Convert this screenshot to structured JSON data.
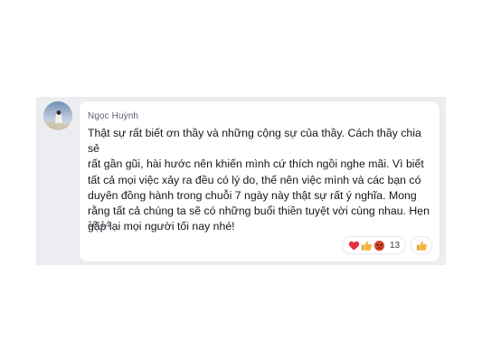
{
  "message": {
    "sender": "Ngọc Huỳnh",
    "lines": [
      "Thật sự rất biết ơn thầy và những cộng sự của thầy. Cách thầy chia sẻ",
      "rất gần gũi, hài hước nên khiến mình cứ thích ngồi nghe mãi. Vì biết",
      "tất cả mọi việc xảy ra đều có lý do, thế nên việc mình và các bạn có",
      "duyên đồng hành trong chuỗi 7 ngày này thật sự rất ý nghĩa. Mong",
      "rằng tất cả chúng ta sẽ có những buổi thiền tuyệt vời cùng nhau. Hẹn",
      "gặp lại mọi người tối nay nhé!"
    ],
    "time": "18:14"
  },
  "reactions": {
    "icons": [
      "heart-icon",
      "thumbs-up-icon",
      "angry-face-icon"
    ],
    "count": "13"
  },
  "like_button": {
    "icon": "thumbs-up-icon"
  },
  "colors": {
    "strip_background": "#ecedf0",
    "bubble_background": "#ffffff",
    "heart": "#e8303f",
    "thumb": "#f2b53a",
    "angry": "#d9482b"
  }
}
